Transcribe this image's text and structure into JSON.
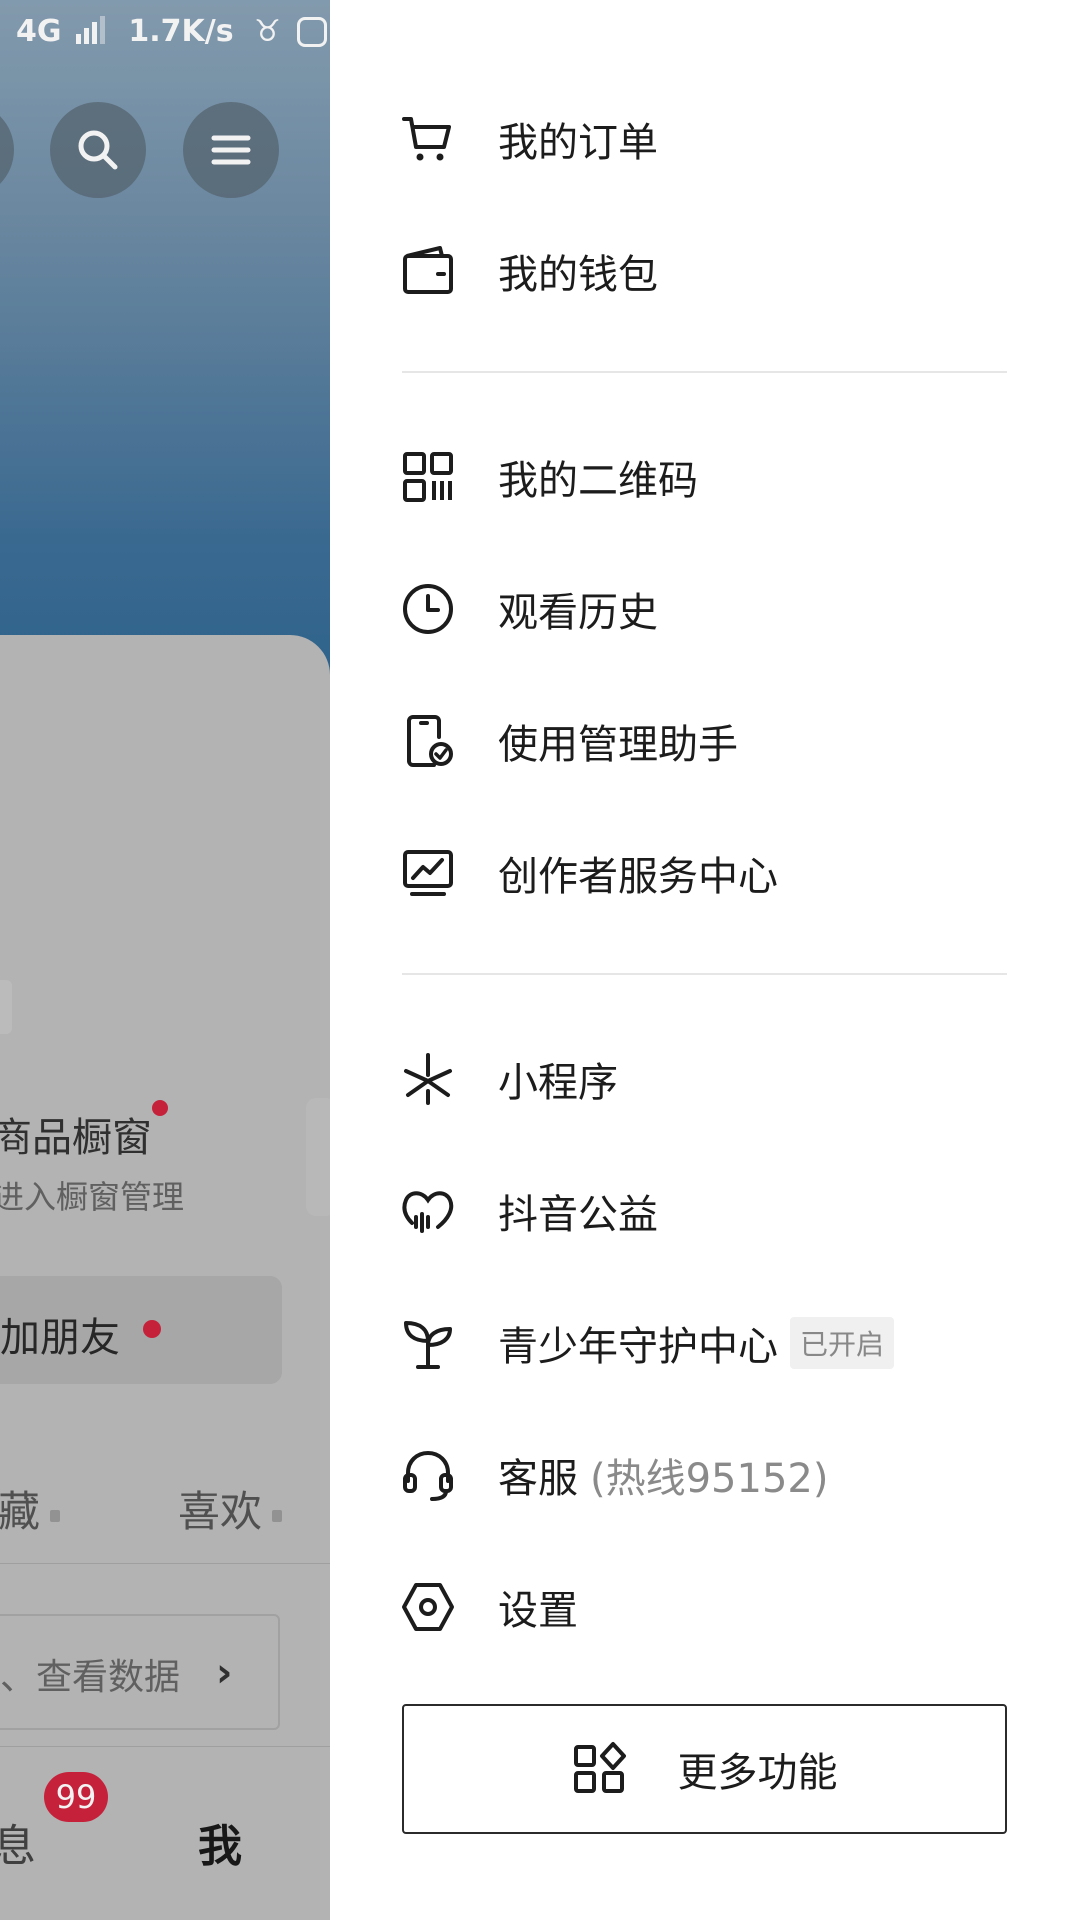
{
  "status_bar": {
    "network": "4G",
    "speed": "1.7K/s"
  },
  "left_panel": {
    "shop_title": "商品橱窗",
    "shop_sub": "进入橱窗管理",
    "add_friend": "加朋友",
    "tab_collect": "收藏",
    "tab_like": "喜欢",
    "data_text": "、查看数据",
    "msg_badge": "99",
    "nav_msg": "息",
    "nav_me": "我"
  },
  "drawer": {
    "items": [
      {
        "label": "我的订单",
        "icon": "cart-icon"
      },
      {
        "label": "我的钱包",
        "icon": "wallet-icon"
      },
      {
        "label": "我的二维码",
        "icon": "qr-code-icon"
      },
      {
        "label": "观看历史",
        "icon": "clock-icon"
      },
      {
        "label": "使用管理助手",
        "icon": "phone-check-icon"
      },
      {
        "label": "创作者服务中心",
        "icon": "monitor-chart-icon"
      },
      {
        "label": "小程序",
        "icon": "mini-program-icon"
      },
      {
        "label": "抖音公益",
        "icon": "heart-charity-icon"
      },
      {
        "label": "青少年守护中心",
        "icon": "sprout-icon",
        "tag": "已开启"
      },
      {
        "label": "客服",
        "icon": "headset-icon",
        "extra": "(热线95152)"
      },
      {
        "label": "设置",
        "icon": "hexagon-settings-icon"
      }
    ],
    "more_button": {
      "label": "更多功能",
      "icon": "grid-apps-icon"
    }
  },
  "colors": {
    "accent_red": "#d1233f",
    "divider": "#e6e6e6",
    "text": "#1c1c1c",
    "muted": "#8a8a8a"
  }
}
